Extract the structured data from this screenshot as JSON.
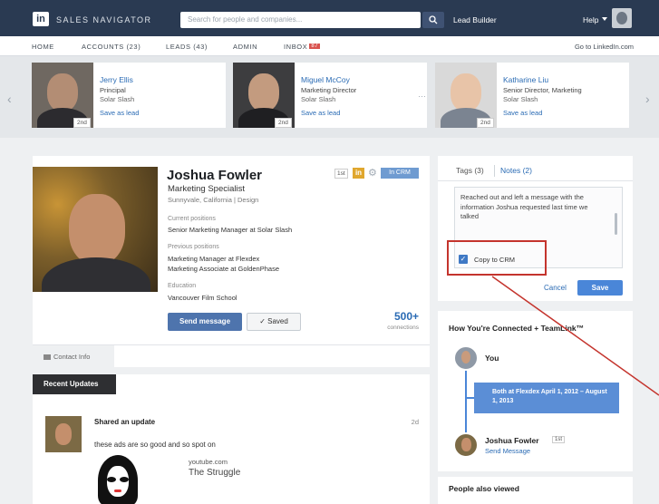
{
  "topbar": {
    "logo": "in",
    "brand": "SALES NAVIGATOR",
    "search_placeholder": "Search for people and companies...",
    "search_icon": "search-icon",
    "lead_builder": "Lead Builder",
    "help": "Help"
  },
  "nav": {
    "home": "HOME",
    "accounts": "ACCOUNTS (23)",
    "leads": "LEADS (43)",
    "admin": "ADMIN",
    "inbox": "INBOX",
    "inbox_badge": "87",
    "linkedin": "Go to LinkedIn.com"
  },
  "recommendations": [
    {
      "name": "Jerry Ellis",
      "title": "Principal",
      "company": "Solar Slash",
      "degree": "2nd",
      "save": "Save as lead"
    },
    {
      "name": "Miguel McCoy",
      "title": "Marketing Director",
      "company": "Solar Slash",
      "degree": "2nd",
      "save": "Save as lead"
    },
    {
      "name": "Katharine Liu",
      "title": "Senior Director, Marketing",
      "company": "Solar Slash",
      "degree": "2nd",
      "save": "Save as lead"
    }
  ],
  "profile": {
    "name": "Joshua Fowler",
    "headline": "Marketing Specialist",
    "location": "Sunnyvale, California | Design",
    "degree": "1st",
    "in_icon": "in",
    "crm_tag": "In CRM",
    "current_label": "Current positions",
    "current": "Senior Marketing Manager at Solar Slash",
    "previous_label": "Previous positions",
    "previous_1": "Marketing Manager at Flexdex",
    "previous_2": "Marketing Associate at GoldenPhase",
    "education_label": "Education",
    "education": "Vancouver Film School",
    "send_message": "Send message",
    "saved": "Saved",
    "connections_count": "500+",
    "connections_label": "connections",
    "contact_info": "Contact Info"
  },
  "updates": {
    "header": "Recent Updates",
    "title": "Shared an update",
    "date": "2d",
    "text": "these ads are so good and so spot on",
    "source_domain": "youtube.com",
    "source_title": "The Struggle"
  },
  "notes": {
    "tags_tab": "Tags (3)",
    "notes_tab": "Notes (2)",
    "text": "Reached out and left a message with the information Joshua requested last time we talked",
    "copy_to_crm": "Copy to CRM",
    "copy_checked": true,
    "cancel": "Cancel",
    "save": "Save"
  },
  "connected": {
    "header": "How You're Connected + TeamLink™",
    "you": "You",
    "bubble": "Both at Flexdex April 1, 2012 – August 1, 2013",
    "name": "Joshua Fowler",
    "degree": "1st",
    "send": "Send Message"
  },
  "also_viewed": {
    "header": "People also viewed"
  },
  "colors": {
    "topbar": "#2a3a52",
    "accent": "#2a6bb4",
    "highlight": "#c4342d"
  }
}
